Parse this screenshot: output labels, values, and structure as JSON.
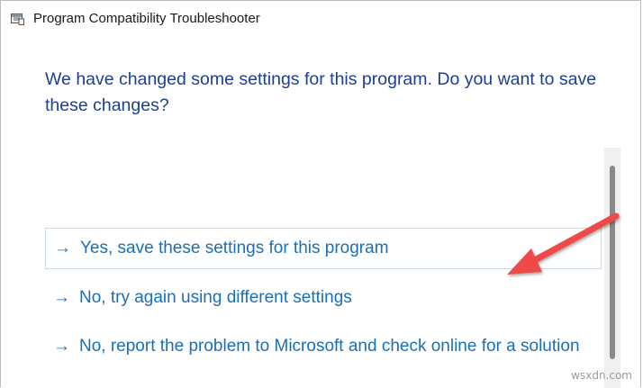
{
  "window": {
    "title": "Program Compatibility Troubleshooter",
    "icon": "troubleshooter-app-icon"
  },
  "main": {
    "heading": "We have changed some settings for this program. Do you want to save these changes?",
    "options": [
      {
        "arrow": "→",
        "label": "Yes, save these settings for this program"
      },
      {
        "arrow": "→",
        "label": "No, try again using different settings"
      },
      {
        "arrow": "→",
        "label": "No, report the problem to Microsoft and check online for a solution"
      }
    ]
  },
  "annotation": {
    "arrow_color": "#ef4a4a",
    "points_to": "Yes, save these settings for this program"
  },
  "watermark": "wsxdn.com",
  "colors": {
    "heading": "#1c3f94",
    "link": "#1a6fb8",
    "selected_border": "#c9d7e8"
  }
}
